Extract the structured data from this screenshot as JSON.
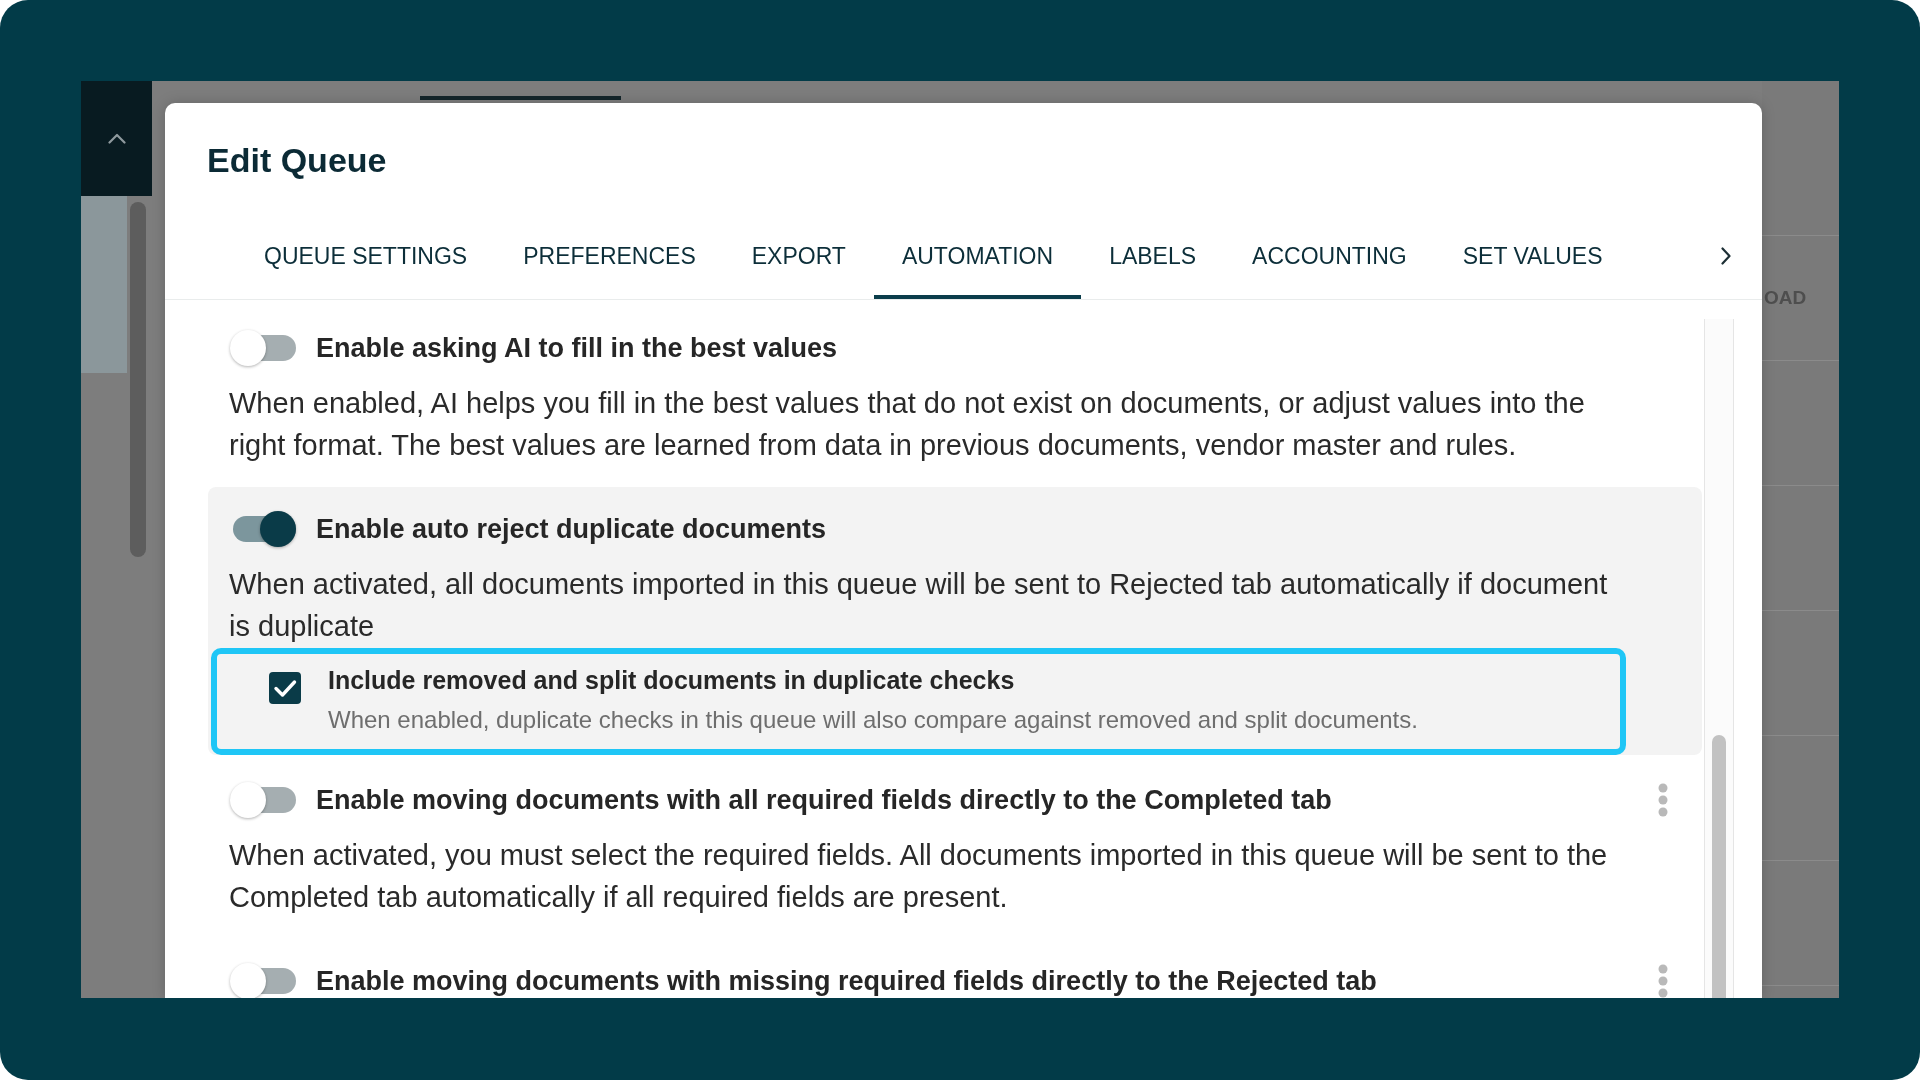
{
  "backdrop": {
    "column_header": "OAD"
  },
  "dialog": {
    "title": "Edit Queue",
    "tabs": [
      {
        "label": "QUEUE SETTINGS",
        "selected": false
      },
      {
        "label": "PREFERENCES",
        "selected": false
      },
      {
        "label": "EXPORT",
        "selected": false
      },
      {
        "label": "AUTOMATION",
        "selected": true
      },
      {
        "label": "LABELS",
        "selected": false
      },
      {
        "label": "ACCOUNTING",
        "selected": false
      },
      {
        "label": "SET VALUES",
        "selected": false
      }
    ],
    "settings": [
      {
        "title": "Enable asking AI to fill in the best values",
        "on": false,
        "more_menu": false,
        "description": "When enabled, AI helps you fill in the best values that do not exist on documents, or adjust values into the right format. The best values are learned from data in previous documents, vendor master and rules."
      },
      {
        "title": "Enable auto reject duplicate documents",
        "on": true,
        "more_menu": false,
        "description": "When activated, all documents imported in this queue will be sent to Rejected tab automatically if document is duplicate",
        "options": [
          {
            "label": "Include removed and split documents in duplicate checks",
            "description": "When enabled, duplicate checks in this queue will also compare against removed and split documents.",
            "checked": true,
            "highlighted": true
          }
        ]
      },
      {
        "title": "Enable moving documents with all required fields directly to the Completed tab",
        "on": false,
        "more_menu": true,
        "description": "When activated, you must select the required fields. All documents imported in this queue will be sent to the Completed tab automatically if all required fields are present."
      },
      {
        "title": "Enable moving documents with missing required fields directly to the Rejected tab",
        "on": false,
        "more_menu": true
      }
    ]
  }
}
